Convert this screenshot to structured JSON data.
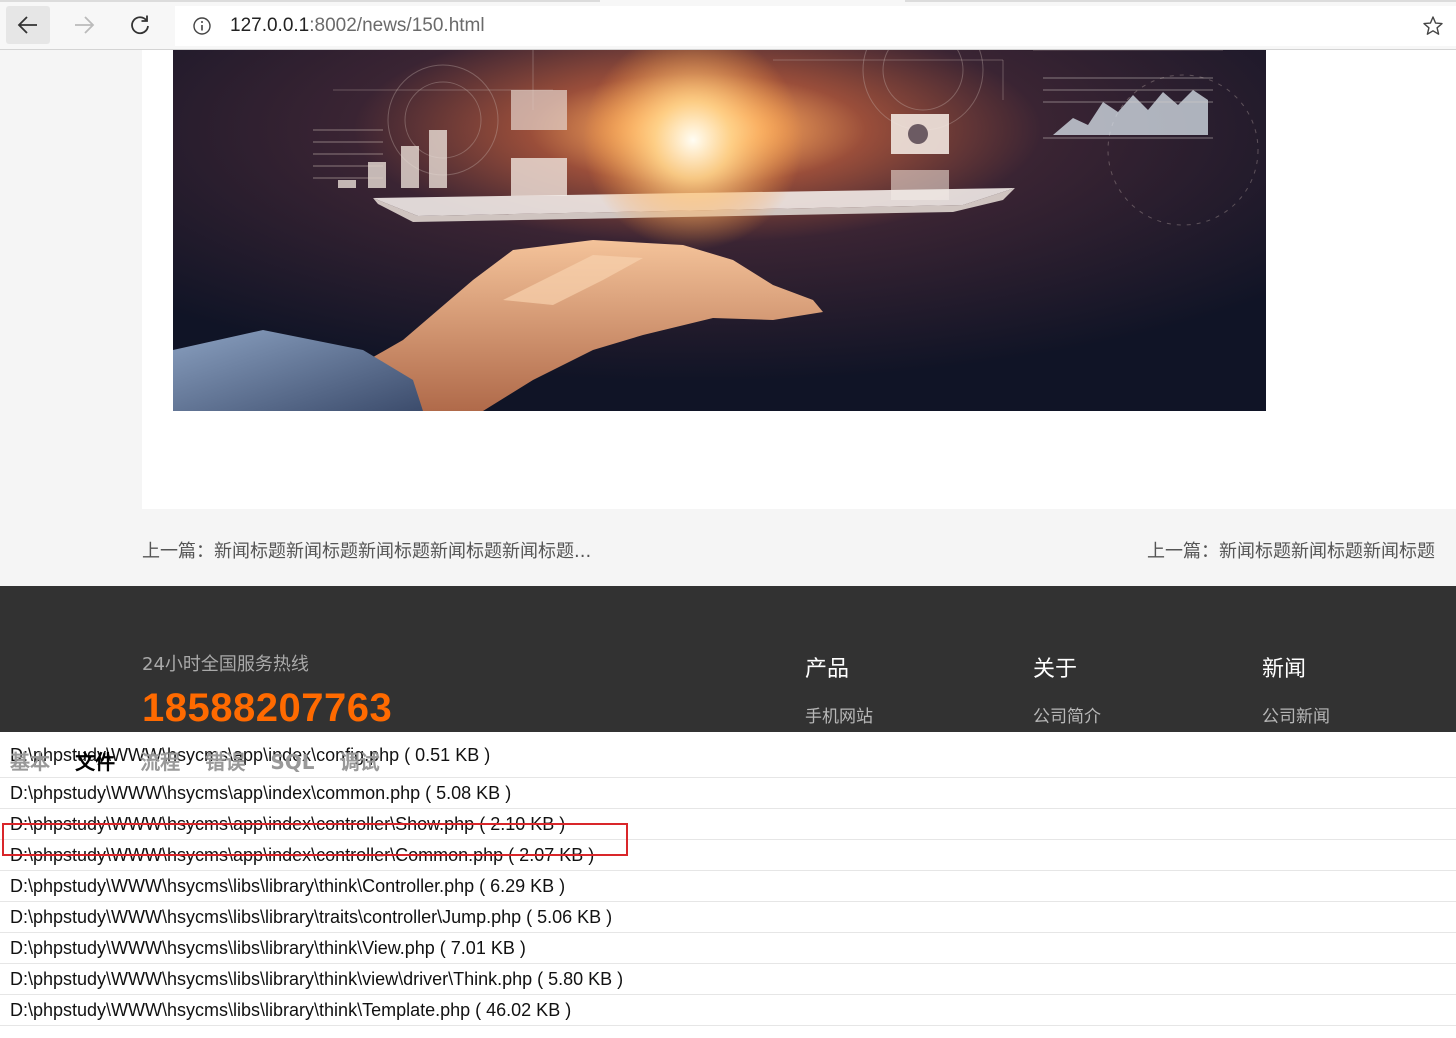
{
  "browser": {
    "url_host": "127.0.0.1",
    "url_rest": ":8002/news/150.html"
  },
  "article": {
    "prev_label": "上一篇：新闻标题新闻标题新闻标题新闻标题新闻标题...",
    "next_label": "上一篇：新闻标题新闻标题新闻标题"
  },
  "footer": {
    "hotline_label": "24小时全国服务热线",
    "hotline_number": "18588207763",
    "columns": [
      {
        "title": "产品",
        "link": "手机网站"
      },
      {
        "title": "关于",
        "link": "公司简介"
      },
      {
        "title": "新闻",
        "link": "公司新闻"
      }
    ]
  },
  "trace": {
    "tabs": [
      "基本",
      "文件",
      "流程",
      "错误",
      "SQL",
      "调试"
    ],
    "active_tab": "文件",
    "files": [
      "D:\\phpstudy\\WWW\\hsycms\\app\\index\\config.php ( 0.51 KB )",
      "D:\\phpstudy\\WWW\\hsycms\\app\\index\\common.php ( 5.08 KB )",
      "D:\\phpstudy\\WWW\\hsycms\\app\\index\\controller\\Show.php ( 2.10 KB )",
      "D:\\phpstudy\\WWW\\hsycms\\app\\index\\controller\\Common.php ( 2.07 KB )",
      "D:\\phpstudy\\WWW\\hsycms\\libs\\library\\think\\Controller.php ( 6.29 KB )",
      "D:\\phpstudy\\WWW\\hsycms\\libs\\library\\traits\\controller\\Jump.php ( 5.06 KB )",
      "D:\\phpstudy\\WWW\\hsycms\\libs\\library\\think\\View.php ( 7.01 KB )",
      "D:\\phpstudy\\WWW\\hsycms\\libs\\library\\think\\view\\driver\\Think.php ( 5.80 KB )",
      "D:\\phpstudy\\WWW\\hsycms\\libs\\library\\think\\Template.php ( 46.02 KB )"
    ],
    "highlight_color": "#d9262a"
  },
  "colors": {
    "hotline": "#ff6a00",
    "footer_bg": "#323232"
  },
  "icons": [
    "back-arrow-icon",
    "forward-arrow-icon",
    "reload-icon",
    "info-icon",
    "star-icon"
  ]
}
